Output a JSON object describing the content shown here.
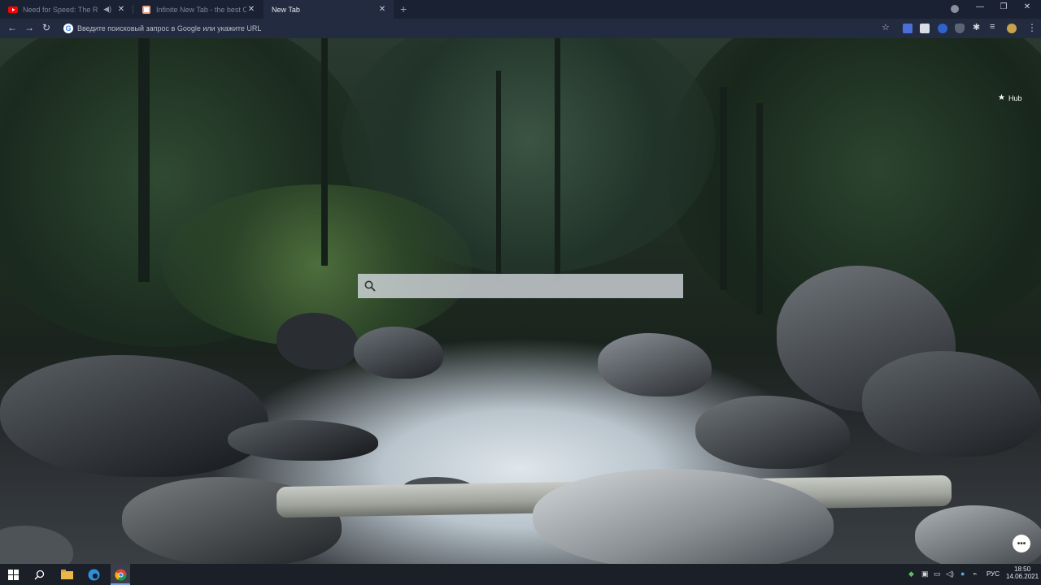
{
  "tabs": [
    {
      "title": "Need for Speed: The Run —",
      "favicon": "youtube-icon",
      "audio": "speaker-icon"
    },
    {
      "title": "Infinite New Tab - the best Chro",
      "favicon": "infinity-tab-icon"
    },
    {
      "title": "New Tab",
      "active": true
    }
  ],
  "toolbar": {
    "address_placeholder": "Введите поисковый запрос в Google или укажите URL"
  },
  "newtab": {
    "hub_label": "Hub",
    "search_placeholder": ""
  },
  "taskbar": {
    "language": "РУС",
    "time": "18:50",
    "date": "14.06.2021"
  },
  "colors": {
    "tabstrip": "#1a2133",
    "toolbar": "#232b40",
    "taskbar": "#1b1f28"
  }
}
